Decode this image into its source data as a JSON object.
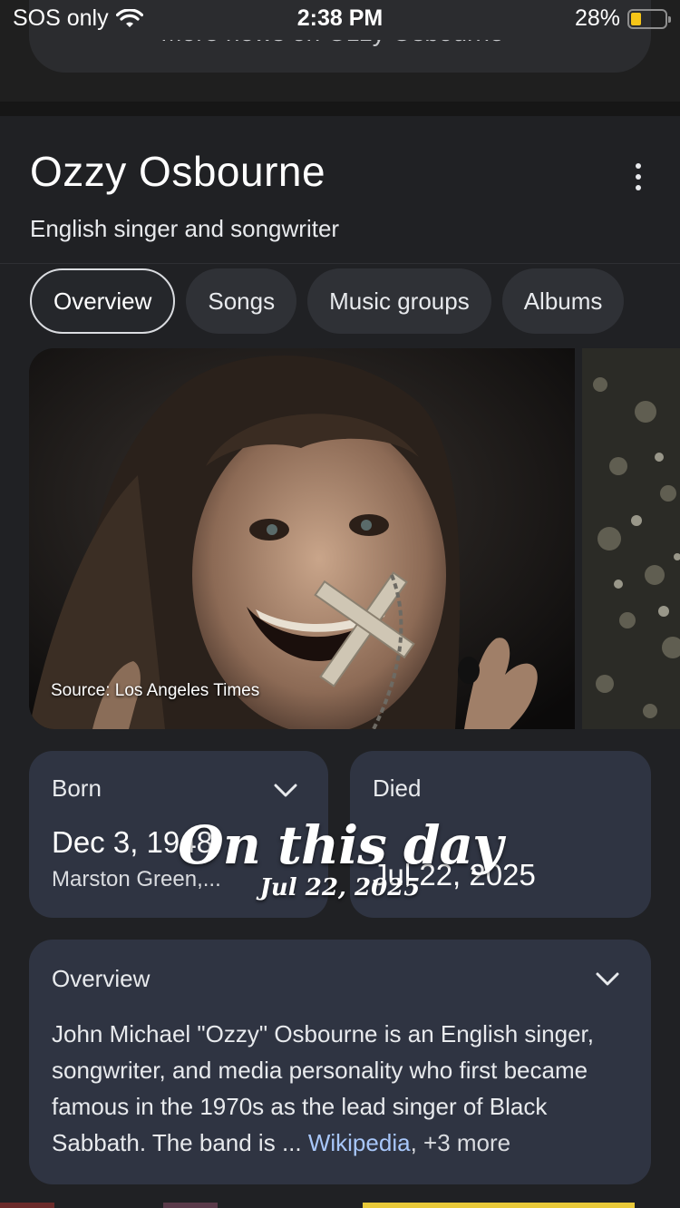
{
  "status_bar": {
    "carrier": "SOS only",
    "time": "2:38 PM",
    "battery_percent": "28%",
    "battery_level": 0.28
  },
  "top": {
    "more_news": "More news on Ozzy Osbourne  ›"
  },
  "entity": {
    "title": "Ozzy Osbourne",
    "subtitle": "English singer and songwriter"
  },
  "tabs": [
    {
      "label": "Overview",
      "active": true
    },
    {
      "label": "Songs",
      "active": false
    },
    {
      "label": "Music groups",
      "active": false
    },
    {
      "label": "Albums",
      "active": false
    }
  ],
  "photo": {
    "caption": "Source: Los Angeles Times"
  },
  "born": {
    "label": "Born",
    "date": "Dec 3, 1948",
    "place": "Marston Green,..."
  },
  "died": {
    "label": "Died",
    "date": "Jul 22, 2025"
  },
  "overlay": {
    "title": "On this day",
    "date": "Jul 22, 2025"
  },
  "overview": {
    "title": "Overview",
    "text": "John Michael \"Ozzy\" Osbourne is an English singer, songwriter, and media personality who first became famous in the 1970s as the lead singer of Black Sabbath. The band is",
    "ellipsis": " ... ",
    "source_link": "Wikipedia",
    "more": ", +3 more"
  },
  "colors": {
    "background": "#202124",
    "card": "#2f3442",
    "link": "#a8c7fa",
    "battery": "#f5c518"
  }
}
